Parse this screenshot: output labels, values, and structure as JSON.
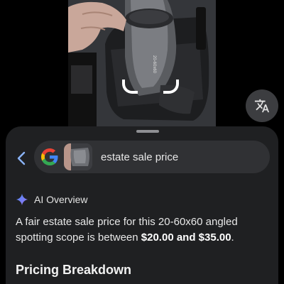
{
  "photo": {
    "scope_label": "20-60x60"
  },
  "translate_button": {
    "icon": "translate-icon"
  },
  "sheet": {
    "back_icon": "chevron-left-icon",
    "search": {
      "logo": "google-g-logo",
      "query": "estate sale price"
    },
    "ai_overview": {
      "icon": "sparkle-icon",
      "title": "AI Overview",
      "text_before": "A fair estate sale price for this 20-60x60 angled spotting scope is between ",
      "text_bold": "$20.00 and $35.00",
      "text_after": "."
    },
    "pricing_heading": "Pricing Breakdown"
  },
  "colors": {
    "sheet_bg": "#1f2022",
    "pill_bg": "#303134",
    "google_blue": "#4285F4",
    "google_red": "#EA4335",
    "google_yellow": "#FBBC05",
    "google_green": "#34A853"
  }
}
